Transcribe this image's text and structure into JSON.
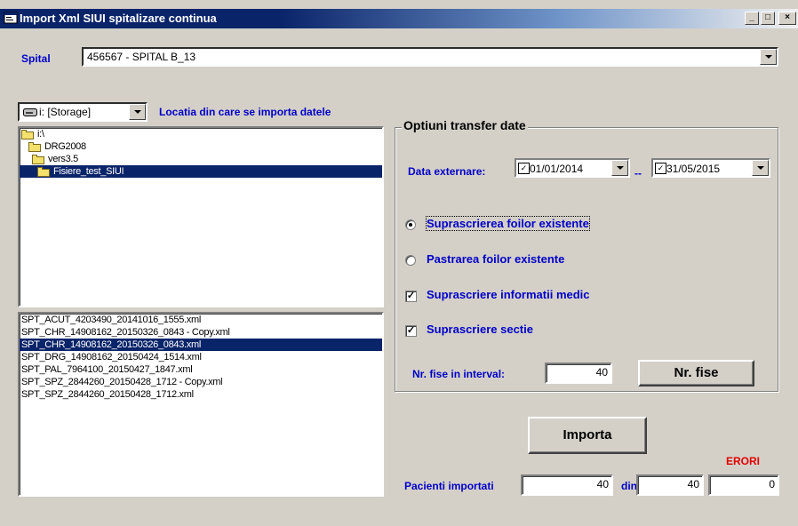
{
  "window": {
    "title": "Import Xml SIUI spitalizare continua",
    "min": "_",
    "max": "□",
    "close": "×"
  },
  "spital": {
    "label": "Spital",
    "value": "456567 - SPITAL B_13"
  },
  "drive": {
    "value": "i: [Storage]",
    "location_label": "Locatia din care se importa datele"
  },
  "folders": [
    {
      "label": "i:\\",
      "selected": false
    },
    {
      "label": "DRG2008",
      "selected": false
    },
    {
      "label": "vers3.5",
      "selected": false
    },
    {
      "label": "Fisiere_test_SIUI",
      "selected": true
    }
  ],
  "files": [
    {
      "label": "SPT_ACUT_4203490_20141016_1555.xml",
      "selected": false
    },
    {
      "label": "SPT_CHR_14908162_20150326_0843 - Copy.xml",
      "selected": false
    },
    {
      "label": "SPT_CHR_14908162_20150326_0843.xml",
      "selected": true
    },
    {
      "label": "SPT_DRG_14908162_20150424_1514.xml",
      "selected": false
    },
    {
      "label": "SPT_PAL_7964100_20150427_1847.xml",
      "selected": false
    },
    {
      "label": "SPT_SPZ_2844260_20150428_1712 - Copy.xml",
      "selected": false
    },
    {
      "label": "SPT_SPZ_2844260_20150428_1712.xml",
      "selected": false
    }
  ],
  "options": {
    "title": "Optiuni transfer date",
    "data_label": "Data externare:",
    "date_from": "01/01/2014",
    "date_sep": "--",
    "date_to": "31/05/2015",
    "radio1": "Suprascrierea foilor existente",
    "radio2": "Pastrarea foilor existente",
    "check1": "Suprascriere informatii medic",
    "check2": "Suprascriere sectie",
    "nr_label": "Nr. fise in interval:",
    "nr_value": "40",
    "nr_button": "Nr. fise"
  },
  "import": {
    "button": "Importa",
    "pacienti_label": "Pacienti importati",
    "pacienti_value": "40",
    "din_label": "din",
    "din_value": "40",
    "erori_label": "ERORI",
    "erori_value": "0"
  }
}
